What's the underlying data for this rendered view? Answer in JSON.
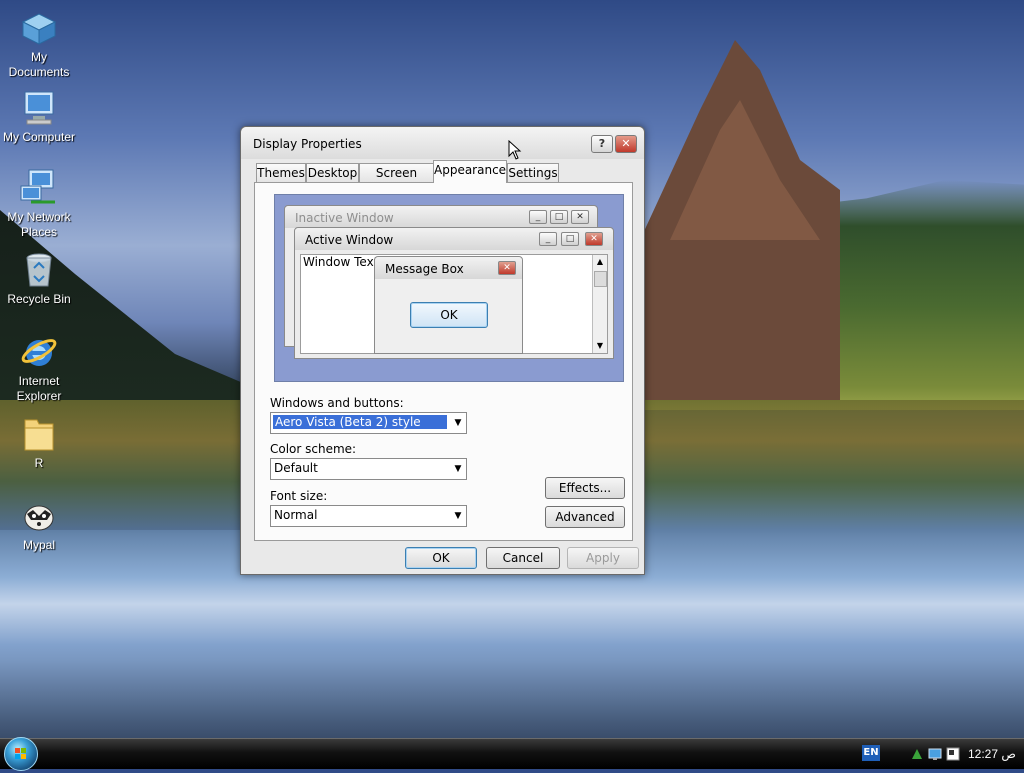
{
  "desktop": {
    "icons": [
      {
        "label": "My Documents",
        "icon": "my-documents-icon"
      },
      {
        "label": "My Computer",
        "icon": "my-computer-icon"
      },
      {
        "label": "My Network Places",
        "icon": "network-places-icon"
      },
      {
        "label": "Recycle Bin",
        "icon": "recycle-bin-icon"
      },
      {
        "label": "Internet Explorer",
        "icon": "internet-explorer-icon"
      },
      {
        "label": "R",
        "icon": "folder-icon"
      },
      {
        "label": "Mypal",
        "icon": "mypal-icon"
      }
    ]
  },
  "dialog": {
    "title": "Display Properties",
    "help_label": "?",
    "close_label": "✕",
    "tabs": [
      {
        "label": "Themes"
      },
      {
        "label": "Desktop"
      },
      {
        "label": "Screen Saver"
      },
      {
        "label": "Appearance",
        "active": true
      },
      {
        "label": "Settings"
      }
    ],
    "preview": {
      "inactive_title": "Inactive Window",
      "active_title": "Active Window",
      "window_text": "Window Text",
      "message_title": "Message Box",
      "message_ok": "OK"
    },
    "windows_buttons_label": "Windows and buttons:",
    "windows_buttons_value": "Aero Vista (Beta 2) style",
    "color_scheme_label": "Color scheme:",
    "color_scheme_value": "Default",
    "font_size_label": "Font size:",
    "font_size_value": "Normal",
    "effects_label": "Effects...",
    "advanced_label": "Advanced",
    "ok_label": "OK",
    "cancel_label": "Cancel",
    "apply_label": "Apply"
  },
  "taskbar": {
    "language": "EN",
    "clock": "ص 12:27"
  },
  "colors": {
    "selection": "#3a6fd8",
    "close_button": "#c0392b"
  }
}
